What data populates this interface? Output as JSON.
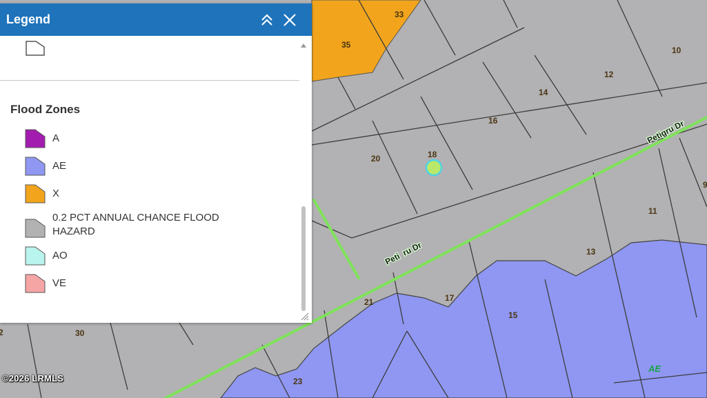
{
  "legend": {
    "title": "Legend",
    "section_title": "Flood Zones",
    "items": [
      {
        "label": "A",
        "color": "#a21caf"
      },
      {
        "label": "AE",
        "color": "#8f97f2"
      },
      {
        "label": "X",
        "color": "#f2a51c"
      },
      {
        "label": "0.2 PCT ANNUAL CHANCE FLOOD HAZARD",
        "color": "#b2b2b2"
      },
      {
        "label": "AO",
        "color": "#b9f4ee"
      },
      {
        "label": "VE",
        "color": "#f6a5a5"
      }
    ],
    "icons": {
      "collapse": "double-chevron-up-icon",
      "close": "close-icon"
    }
  },
  "map": {
    "lots": [
      {
        "label": "33"
      },
      {
        "label": "35"
      },
      {
        "label": "10"
      },
      {
        "label": "12"
      },
      {
        "label": "14"
      },
      {
        "label": "16"
      },
      {
        "label": "20"
      },
      {
        "label": "18"
      },
      {
        "label": "9"
      },
      {
        "label": "11"
      },
      {
        "label": "13"
      },
      {
        "label": "17"
      },
      {
        "label": "21"
      },
      {
        "label": "15"
      },
      {
        "label": "30"
      },
      {
        "label": "2"
      },
      {
        "label": "23"
      }
    ],
    "roads": {
      "upper": "Petigru Dr",
      "lower": "Peti  ru Dr"
    },
    "zone_label": "AE",
    "colors": {
      "gray_zone": "#b2b1b3",
      "ae_zone": "#8f97f2",
      "x_zone": "#f2a51c",
      "road": "#7fe35a",
      "marker": "#b9e86a"
    }
  },
  "copyright": "©2026 LRMLS"
}
